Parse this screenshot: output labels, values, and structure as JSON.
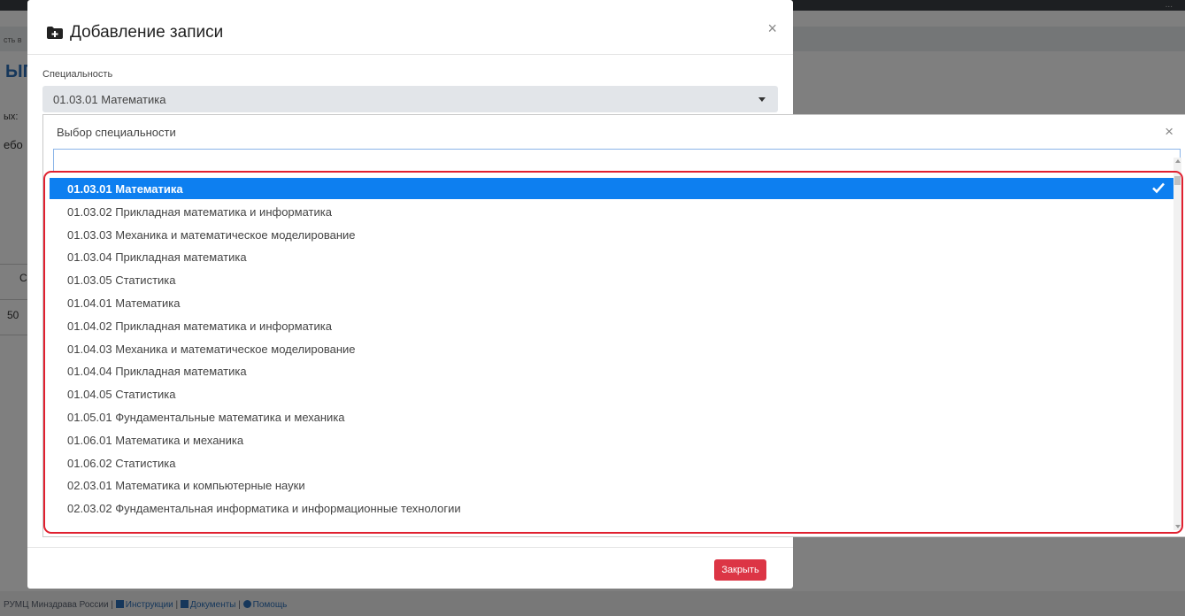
{
  "background": {
    "top_right_text": "...",
    "breadcrumb": "сть в",
    "heading_fragment": "ЫП",
    "label_fragment_1": "ых:",
    "label_fragment_2": "ебо",
    "column_fragment": "С",
    "value_fragment": "50"
  },
  "modal": {
    "title": "Добавление записи",
    "close_symbol": "×",
    "field_label": "Специальность",
    "selected_value": "01.03.01 Математика",
    "close_button_label": "Закрыть"
  },
  "dropdown": {
    "title": "Выбор специальности",
    "close_symbol": "×",
    "search_placeholder": "",
    "items": [
      {
        "label": "01.03.01 Математика",
        "selected": true
      },
      {
        "label": "01.03.02 Прикладная математика и информатика",
        "selected": false
      },
      {
        "label": "01.03.03 Механика и математическое моделирование",
        "selected": false
      },
      {
        "label": "01.03.04 Прикладная математика",
        "selected": false
      },
      {
        "label": "01.03.05 Статистика",
        "selected": false
      },
      {
        "label": "01.04.01 Математика",
        "selected": false
      },
      {
        "label": "01.04.02 Прикладная математика и информатика",
        "selected": false
      },
      {
        "label": "01.04.03 Механика и математическое моделирование",
        "selected": false
      },
      {
        "label": "01.04.04 Прикладная математика",
        "selected": false
      },
      {
        "label": "01.04.05 Статистика",
        "selected": false
      },
      {
        "label": "01.05.01 Фундаментальные математика и механика",
        "selected": false
      },
      {
        "label": "01.06.01 Математика и механика",
        "selected": false
      },
      {
        "label": "01.06.02 Статистика",
        "selected": false
      },
      {
        "label": "02.03.01 Математика и компьютерные науки",
        "selected": false
      },
      {
        "label": "02.03.02 Фундаментальная информатика и информационные технологии",
        "selected": false
      }
    ]
  },
  "footer": {
    "org": "РУМЦ Минздрава России",
    "sep": "|",
    "link_instructions": "Инструкции",
    "link_documents": "Документы",
    "link_help": "Помощь"
  },
  "colors": {
    "selected_bg": "#0d7ff0",
    "highlight_border": "#e0202f",
    "close_button": "#dc3545",
    "link": "#2c6fb7"
  }
}
